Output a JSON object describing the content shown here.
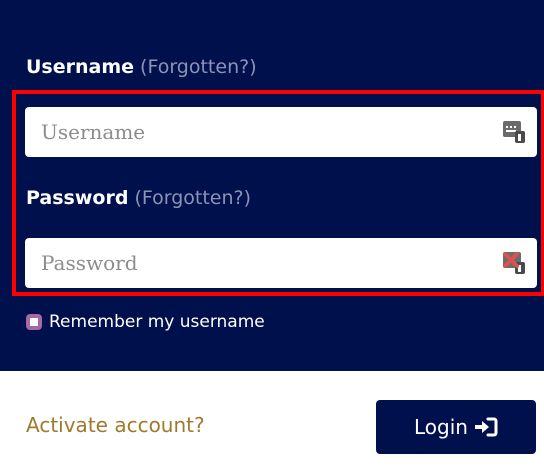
{
  "colors": {
    "panel_background": "#00104d",
    "white": "#ffffff",
    "forgotten_link": "#8c93b4",
    "highlight_border": "#ff0000",
    "activate_link": "#a07a2c",
    "login_button": "#00104d"
  },
  "username": {
    "label": "Username",
    "forgotten": "(Forgotten?)",
    "placeholder": "Username",
    "value": "",
    "icon": "keyboard-key-icon"
  },
  "password": {
    "label": "Password",
    "forgotten": "(Forgotten?)",
    "placeholder": "Password",
    "value": "",
    "icon": "keyboard-key-error-icon"
  },
  "remember": {
    "label": "Remember my username",
    "checked": false
  },
  "footer": {
    "activate_label": "Activate account?",
    "login_label": "Login",
    "login_icon": "sign-in-icon"
  }
}
